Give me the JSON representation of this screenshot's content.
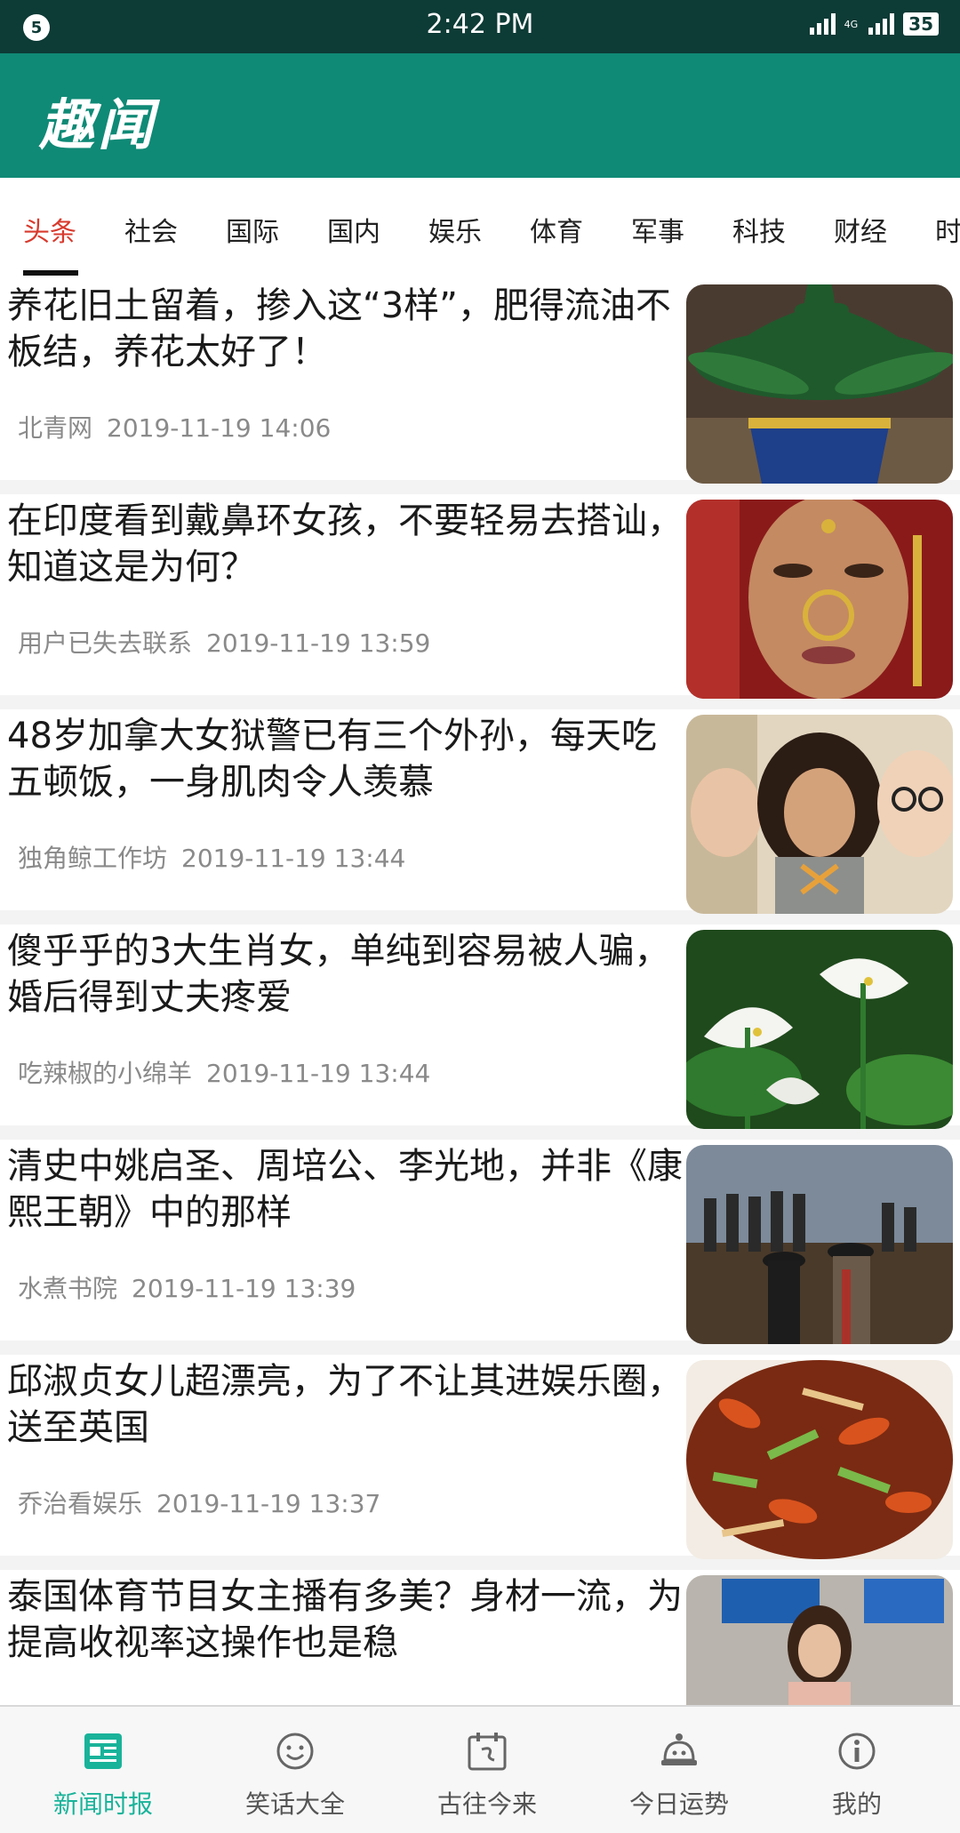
{
  "status_bar": {
    "notification_count": "5",
    "time": "2:42 PM",
    "network_tag": "4G",
    "battery": "35"
  },
  "header": {
    "logo": "趣闻"
  },
  "tabs": [
    {
      "label": "头条",
      "active": true
    },
    {
      "label": "社会"
    },
    {
      "label": "国际"
    },
    {
      "label": "国内"
    },
    {
      "label": "娱乐"
    },
    {
      "label": "体育"
    },
    {
      "label": "军事"
    },
    {
      "label": "科技"
    },
    {
      "label": "财经"
    },
    {
      "label": "时"
    }
  ],
  "news": [
    {
      "title": "养花旧土留着，掺入这“3样”，肥得流油不板结，养花太好了！",
      "source": "北青网",
      "time": "2019-11-19 14:06",
      "image": "potted-plant"
    },
    {
      "title": "在印度看到戴鼻环女孩，不要轻易去搭讪，知道这是为何？",
      "source": "用户已失去联系",
      "time": "2019-11-19 13:59",
      "image": "bride-portrait"
    },
    {
      "title": "48岁加拿大女狱警已有三个外孙，每天吃五顿饭，一身肌肉令人羡慕",
      "source": "独角鲸工作坊",
      "time": "2019-11-19 13:44",
      "image": "group-selfie"
    },
    {
      "title": "傻乎乎的3大生肖女，单纯到容易被人骗，婚后得到丈夫疼爱",
      "source": "吃辣椒的小绵羊",
      "time": "2019-11-19 13:44",
      "image": "calla-lilies"
    },
    {
      "title": "清史中姚启圣、周培公、李光地，并非《康熙王朝》中的那样",
      "source": "水煮书院",
      "time": "2019-11-19 13:39",
      "image": "drama-scene"
    },
    {
      "title": "邱淑贞女儿超漂亮，为了不让其进娱乐圈，送至英国",
      "source": "乔治看娱乐",
      "time": "2019-11-19 13:37",
      "image": "stir-fry-dish"
    },
    {
      "title": "泰国体育节目女主播有多美？身材一流，为提高收视率这操作也是稳",
      "source": "",
      "time": "",
      "image": "tv-studio"
    }
  ],
  "bottom_nav": [
    {
      "label": "新闻时报",
      "icon": "newspaper-icon",
      "active": true
    },
    {
      "label": "笑话大全",
      "icon": "smiley-icon"
    },
    {
      "label": "古往今来",
      "icon": "calendar-icon"
    },
    {
      "label": "今日运势",
      "icon": "fortune-icon"
    },
    {
      "label": "我的",
      "icon": "info-icon"
    }
  ],
  "colors": {
    "status_bar": "#0d3b36",
    "header": "#0f8a76",
    "active_tab": "#d83a2d",
    "active_nav": "#19b39a"
  }
}
